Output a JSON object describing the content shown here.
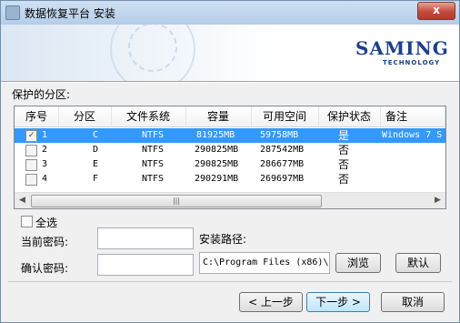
{
  "window": {
    "title": "数据恢复平台 安装",
    "close_label": "x"
  },
  "banner": {
    "logo_main": "SAMING",
    "logo_sub": "TECHNOLOGY"
  },
  "partitions_label": "保护的分区:",
  "table": {
    "columns": [
      "序号",
      "分区",
      "文件系统",
      "容量",
      "可用空间",
      "保护状态",
      "备注"
    ],
    "rows": [
      {
        "checked": true,
        "index": "1",
        "partition": "C",
        "fs": "NTFS",
        "capacity": "81925MB",
        "free": "59758MB",
        "status": "是",
        "note": "Windows 7 S"
      },
      {
        "checked": false,
        "index": "2",
        "partition": "D",
        "fs": "NTFS",
        "capacity": "290825MB",
        "free": "287542MB",
        "status": "否",
        "note": ""
      },
      {
        "checked": false,
        "index": "3",
        "partition": "E",
        "fs": "NTFS",
        "capacity": "290825MB",
        "free": "286677MB",
        "status": "否",
        "note": ""
      },
      {
        "checked": false,
        "index": "4",
        "partition": "F",
        "fs": "NTFS",
        "capacity": "290291MB",
        "free": "269697MB",
        "status": "否",
        "note": ""
      }
    ],
    "scroll_left": "◀",
    "scroll_right": "▶",
    "thumb_grip": "|||"
  },
  "select_all_label": "全选",
  "current_password_label": "当前密码:",
  "confirm_password_label": "确认密码:",
  "install_path_label": "安装路径:",
  "install_path_value": "C:\\Program Files (x86)\\",
  "buttons": {
    "browse": "浏览",
    "default": "默认",
    "back": "< 上一步",
    "next": "下一步 >",
    "cancel": "取消"
  }
}
